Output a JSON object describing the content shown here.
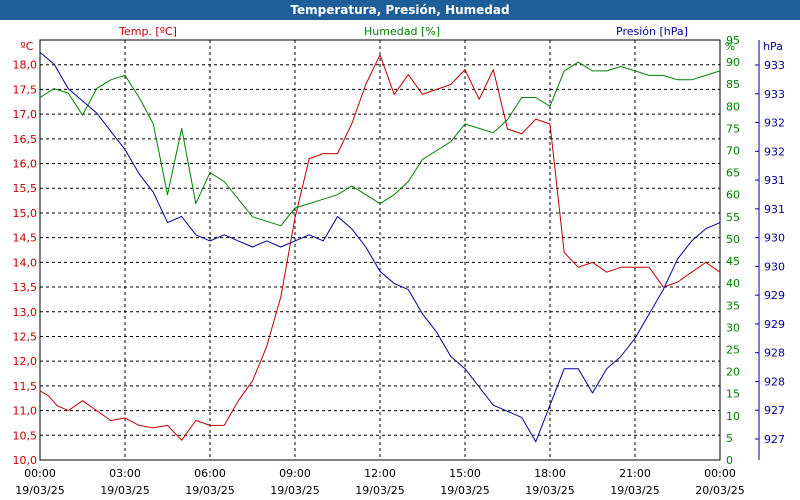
{
  "window": {
    "title": "Temperatura, Presión, Humedad"
  },
  "chart_data": {
    "type": "line",
    "title": "Temperatura, Presión, Humedad",
    "grid": true,
    "x_ticks": [
      {
        "time": "00:00",
        "date": "19/03/25"
      },
      {
        "time": "03:00",
        "date": "19/03/25"
      },
      {
        "time": "06:00",
        "date": "19/03/25"
      },
      {
        "time": "09:00",
        "date": "19/03/25"
      },
      {
        "time": "12:00",
        "date": "19/03/25"
      },
      {
        "time": "15:00",
        "date": "19/03/25"
      },
      {
        "time": "18:00",
        "date": "19/03/25"
      },
      {
        "time": "21:00",
        "date": "19/03/25"
      },
      {
        "time": "00:00",
        "date": "20/03/25"
      }
    ],
    "xlim": [
      0,
      24
    ],
    "axes": {
      "left": {
        "label": "Temp. [ºC]",
        "unit": "ºC",
        "ylim": [
          10,
          18.5
        ],
        "color": "#c00000",
        "ticks": [
          "10,0",
          "10,5",
          "11,0",
          "11,5",
          "12,0",
          "12,5",
          "13,0",
          "13,5",
          "14,0",
          "14,5",
          "15,0",
          "15,5",
          "16,0",
          "16,5",
          "17,0",
          "17,5",
          "18,0"
        ]
      },
      "middle": {
        "label": "Humedad [%]",
        "unit": "%",
        "ylim": [
          0,
          95
        ],
        "color": "#008000",
        "ticks": [
          "0",
          "5",
          "10",
          "15",
          "20",
          "25",
          "30",
          "35",
          "40",
          "45",
          "50",
          "55",
          "60",
          "65",
          "70",
          "75",
          "80",
          "85",
          "90",
          "95"
        ]
      },
      "right": {
        "label": "Presión [hPa]",
        "unit": "hPa",
        "ylim": [
          926.4,
          933.3
        ],
        "color": "#000099",
        "ticks": [
          "927",
          "927",
          "928",
          "928",
          "929",
          "929",
          "930",
          "930",
          "931",
          "931",
          "932",
          "932",
          "933",
          "933"
        ]
      }
    },
    "series": [
      {
        "name": "Temp. [ºC]",
        "axis": "left",
        "color": "#c00000",
        "x": [
          0,
          0.3,
          0.6,
          1,
          1.5,
          2,
          2.5,
          3,
          3.5,
          4,
          4.5,
          5,
          5.5,
          6,
          6.5,
          7,
          7.5,
          8,
          8.5,
          9,
          9.5,
          10,
          10.5,
          11,
          11.5,
          12,
          12.5,
          13,
          13.5,
          14,
          14.5,
          15,
          15.5,
          16,
          16.5,
          17,
          17.5,
          18,
          18.5,
          19,
          19.5,
          20,
          20.5,
          21,
          21.5,
          22,
          22.5,
          23,
          23.5,
          24
        ],
        "y": [
          11.4,
          11.3,
          11.1,
          11.0,
          11.2,
          11.0,
          10.8,
          10.85,
          10.7,
          10.65,
          10.7,
          10.4,
          10.8,
          10.7,
          10.7,
          11.2,
          11.6,
          12.3,
          13.3,
          14.9,
          16.1,
          16.2,
          16.2,
          16.8,
          17.6,
          18.2,
          17.4,
          17.8,
          17.4,
          17.5,
          17.6,
          17.9,
          17.3,
          17.9,
          16.7,
          16.6,
          16.9,
          16.8,
          14.2,
          13.9,
          14.0,
          13.8,
          13.9,
          13.9,
          13.9,
          13.5,
          13.6,
          13.8,
          14.0,
          13.8
        ]
      },
      {
        "name": "Humedad [%]",
        "axis": "middle",
        "color": "#008000",
        "x": [
          0,
          0.5,
          1,
          1.5,
          2,
          2.5,
          3,
          3.5,
          4,
          4.5,
          5,
          5.5,
          6,
          6.5,
          7,
          7.5,
          8,
          8.5,
          9,
          9.5,
          10,
          10.5,
          11,
          11.5,
          12,
          12.5,
          13,
          13.5,
          14,
          14.5,
          15,
          15.5,
          16,
          16.5,
          17,
          17.5,
          18,
          18.5,
          19,
          19.5,
          20,
          20.5,
          21,
          21.5,
          22,
          22.5,
          23,
          23.5,
          24
        ],
        "y": [
          82,
          84,
          83,
          78,
          84,
          86,
          87,
          82,
          76,
          60,
          75,
          58,
          65,
          63,
          59,
          55,
          54,
          53,
          57,
          58,
          59,
          60,
          62,
          60,
          58,
          60,
          63,
          68,
          70,
          72,
          76,
          75,
          74,
          77,
          82,
          82,
          80,
          88,
          90,
          88,
          88,
          89,
          88,
          87,
          87,
          86,
          86,
          87,
          88
        ]
      },
      {
        "name": "Presión [hPa]",
        "axis": "right",
        "color": "#000099",
        "x": [
          0,
          0.5,
          1,
          1.5,
          2,
          2.5,
          3,
          3.5,
          4,
          4.5,
          5,
          5.5,
          6,
          6.5,
          7,
          7.5,
          8,
          8.5,
          9,
          9.5,
          10,
          10.5,
          11,
          11.5,
          12,
          12.5,
          13,
          13.5,
          14,
          14.5,
          15,
          15.5,
          16,
          16.5,
          17,
          17.5,
          18,
          18.5,
          19,
          19.5,
          20,
          20.5,
          21,
          21.5,
          22,
          22.5,
          23,
          23.5,
          24
        ],
        "y": [
          933.1,
          932.9,
          932.5,
          932.3,
          932.1,
          931.8,
          931.5,
          931.1,
          930.8,
          930.3,
          930.4,
          930.1,
          930.0,
          930.1,
          930.0,
          929.9,
          930.0,
          929.9,
          930.0,
          930.1,
          930.0,
          930.4,
          930.2,
          929.9,
          929.5,
          929.3,
          929.2,
          928.8,
          928.5,
          928.1,
          927.9,
          927.6,
          927.3,
          927.2,
          927.1,
          926.7,
          927.3,
          927.9,
          927.9,
          927.5,
          927.9,
          928.1,
          928.4,
          928.8,
          929.2,
          929.7,
          930.0,
          930.2,
          930.3
        ]
      }
    ]
  }
}
